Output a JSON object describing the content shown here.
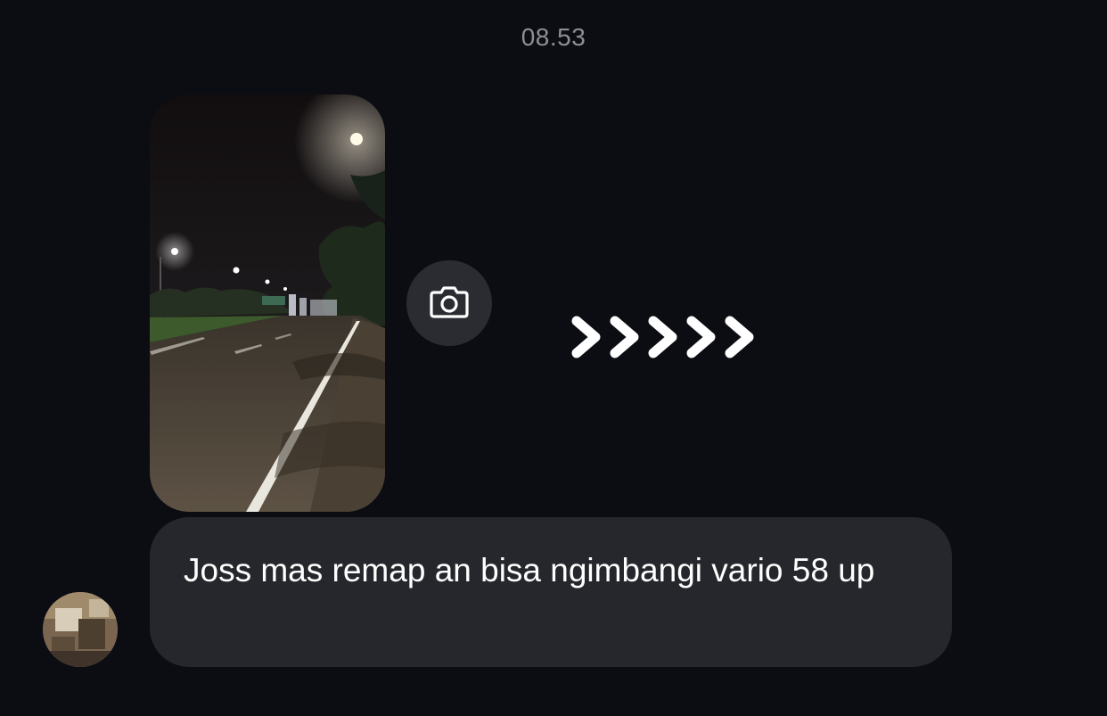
{
  "chat": {
    "timestamp": "08.53",
    "arrows_text": ">>>>>",
    "media": {
      "type": "photo",
      "camera_icon": "camera-icon"
    },
    "message": {
      "text": "Joss mas remap an bisa ngimbangi vario 58 up"
    },
    "sender": {
      "avatar_icon": "avatar"
    }
  },
  "colors": {
    "background": "#0b0d12",
    "bubble": "#25272c",
    "camera_button": "#2a2c31",
    "timestamp_text": "#8e8f94",
    "message_text": "#ffffff"
  }
}
